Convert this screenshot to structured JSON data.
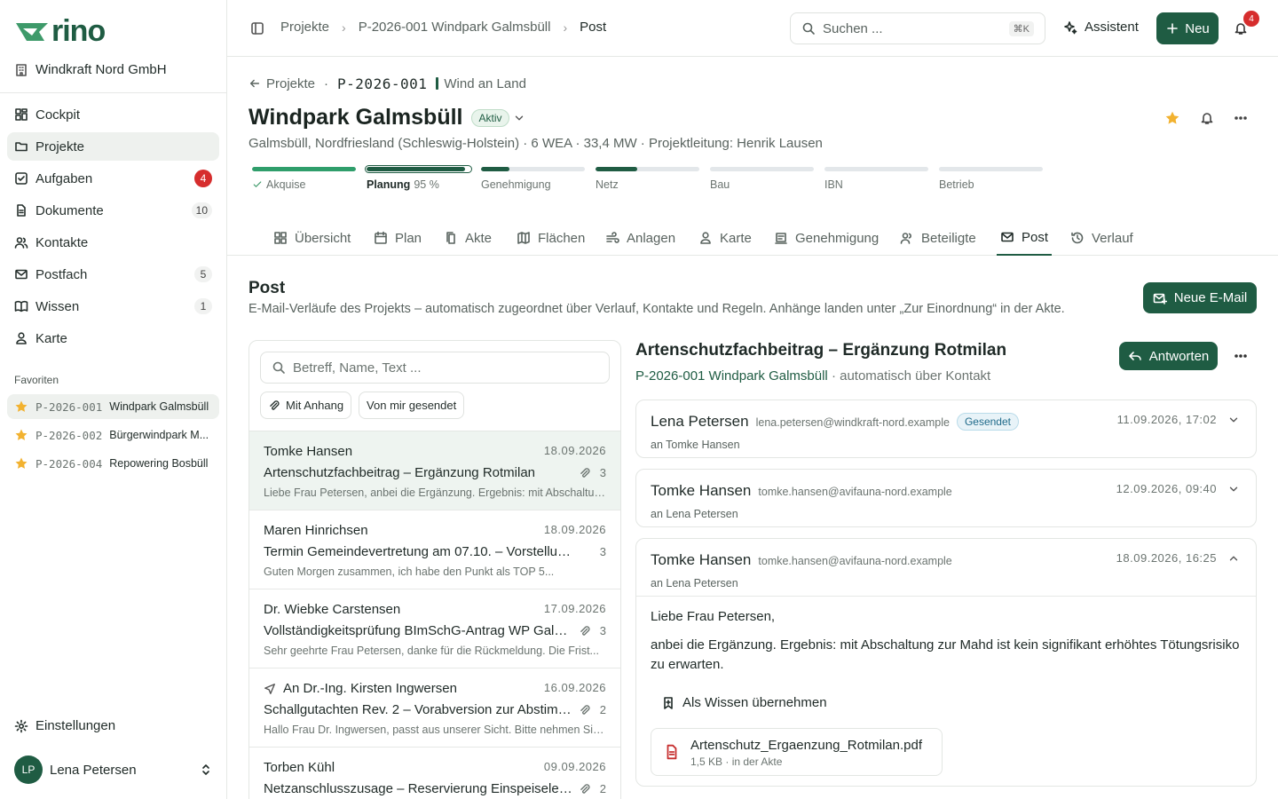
{
  "brand": {
    "logo_text": "rino",
    "org": "Windkraft Nord GmbH",
    "accent": "#1f5c43"
  },
  "nav": [
    {
      "label": "Cockpit",
      "icon": "grid-icon",
      "count": null
    },
    {
      "label": "Projekte",
      "icon": "folder-icon",
      "count": null,
      "active": true
    },
    {
      "label": "Aufgaben",
      "icon": "checkbox-icon",
      "count": "4"
    },
    {
      "label": "Dokumente",
      "icon": "document-icon",
      "count": "10"
    },
    {
      "label": "Kontakte",
      "icon": "people-icon",
      "count": null
    },
    {
      "label": "Postfach",
      "icon": "mail-icon",
      "count": "5"
    },
    {
      "label": "Wissen",
      "icon": "book-icon",
      "count": "1"
    },
    {
      "label": "Karte",
      "icon": "map-pin-icon",
      "count": null
    }
  ],
  "favorites": {
    "heading": "Favoriten",
    "items": [
      {
        "id": "P-2026-001",
        "name": "Windpark Galmsbüll"
      },
      {
        "id": "P-2026-002",
        "name": "Bürgerwindpark M..."
      },
      {
        "id": "P-2026-004",
        "name": "Repowering Bosbüll"
      }
    ]
  },
  "settings_label": "Einstellungen",
  "user": {
    "initials": "LP",
    "name": "Lena Petersen"
  },
  "topbar": {
    "breadcrumbs": [
      "Projekte",
      "P-2026-001 Windpark Galmsbüll",
      "Post"
    ],
    "search_placeholder": "Suchen ...",
    "search_shortcut": "⌘K",
    "assistant_label": "Assistent",
    "new_label": "Neu",
    "notifications": "4"
  },
  "project": {
    "back_label": "Projekte",
    "id": "P-2026-001",
    "category": "Wind an Land",
    "title": "Windpark Galmsbüll",
    "status": "Aktiv",
    "subtitle": "Galmsbüll, Nordfriesland (Schleswig-Holstein) · 6 WEA · 33,4 MW · Projektleitung: Henrik Lausen"
  },
  "phases": [
    {
      "label": "Akquise",
      "progress": 1.0,
      "done": true
    },
    {
      "label": "Planung",
      "progress": 0.95,
      "current": true,
      "pct": "95 %"
    },
    {
      "label": "Genehmigung",
      "progress": 0.27
    },
    {
      "label": "Netz",
      "progress": 0.4
    },
    {
      "label": "Bau",
      "progress": 0
    },
    {
      "label": "IBN",
      "progress": 0
    },
    {
      "label": "Betrieb",
      "progress": 0
    }
  ],
  "tabs": [
    "Übersicht",
    "Plan",
    "Akte",
    "Flächen",
    "Anlagen",
    "Karte",
    "Genehmigung",
    "Beteiligte",
    "Post",
    "Verlauf"
  ],
  "active_tab": "Post",
  "post": {
    "title": "Post",
    "description": "E-Mail-Verläufe des Projekts – automatisch zugeordnet über Verlauf, Kontakte und Regeln. Anhänge landen unter „Zur Einordnung“ in der Akte.",
    "new_mail_label": "Neue E-Mail"
  },
  "list": {
    "search_placeholder": "Betreff, Name, Text ...",
    "chips": [
      "Mit Anhang",
      "Von mir gesendet"
    ],
    "mails": [
      {
        "sender": "Tomke Hansen",
        "date": "18.09.2026",
        "subject": "Artenschutzfachbeitrag – Ergänzung Rotmilan",
        "attachment": true,
        "count": "3",
        "preview": "Liebe Frau Petersen, anbei die Ergänzung. Ergebnis: mit Abschaltun...",
        "selected": true
      },
      {
        "sender": "Maren Hinrichsen",
        "date": "18.09.2026",
        "subject": "Termin Gemeindevertretung am 07.10. – Vorstellung Win...",
        "attachment": false,
        "count": "3",
        "preview": "Guten Morgen zusammen, ich habe den Punkt als TOP 5..."
      },
      {
        "sender": "Dr. Wiebke Carstensen",
        "date": "17.09.2026",
        "subject": "Vollständigkeitsprüfung BImSchG-Antrag WP Galm...",
        "attachment": true,
        "count": "3",
        "preview": "Sehr geehrte Frau Petersen, danke für die Rückmeldung. Die Frist..."
      },
      {
        "sender": "An Dr.-Ing. Kirsten Ingwersen",
        "date": "16.09.2026",
        "subject": "Schallgutachten Rev. 2 – Vorabversion zur Abstimm...",
        "attachment": true,
        "count": "2",
        "preview": "Hallo Frau Dr. Ingwersen, passt aus unserer Sicht. Bitte nehmen Sie...",
        "sent": true
      },
      {
        "sender": "Torben Kühl",
        "date": "09.09.2026",
        "subject": "Netzanschlusszusage – Reservierung Einspeiseleist...",
        "attachment": true,
        "count": "2",
        "preview": ""
      }
    ]
  },
  "thread": {
    "title": "Artenschutzfachbeitrag – Ergänzung Rotmilan",
    "project_link": "P-2026-001 Windpark Galmsbüll",
    "assignment": "· automatisch über Kontakt",
    "reply_label": "Antworten",
    "messages": [
      {
        "name": "Lena Petersen",
        "email": "lena.petersen@windkraft-nord.example",
        "badge": "Gesendet",
        "to": "an Tomke Hansen",
        "date": "11.09.2026, 17:02"
      },
      {
        "name": "Tomke Hansen",
        "email": "tomke.hansen@avifauna-nord.example",
        "to": "an Lena Petersen",
        "date": "12.09.2026, 09:40"
      },
      {
        "name": "Tomke Hansen",
        "email": "tomke.hansen@avifauna-nord.example",
        "to": "an Lena Petersen",
        "date": "18.09.2026, 16:25",
        "greeting": "Liebe Frau Petersen,",
        "body": "anbei die Ergänzung. Ergebnis: mit Abschaltung zur Mahd ist kein signifikant erhöhtes Tötungsrisiko zu erwarten.",
        "wissen_label": "Als Wissen übernehmen",
        "attachment": {
          "name": "Artenschutz_Ergaenzung_Rotmilan.pdf",
          "meta": "1,5 KB · in der Akte"
        }
      }
    ]
  }
}
